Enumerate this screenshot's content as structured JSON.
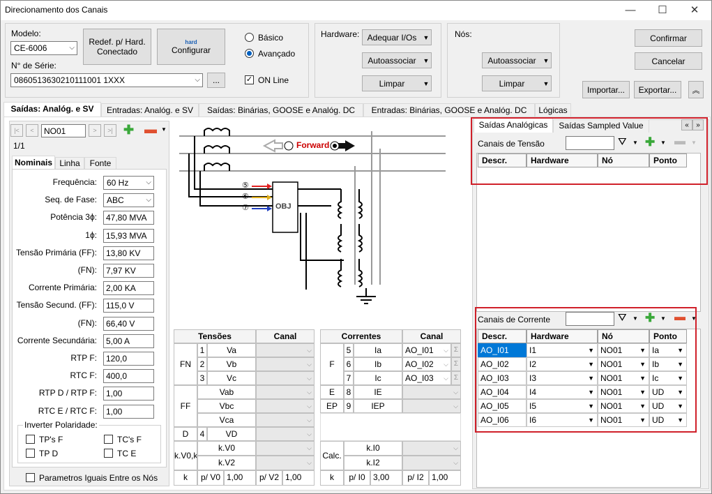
{
  "window": {
    "title": "Direcionamento dos Canais",
    "min": "—",
    "max": "☐",
    "close": "✕"
  },
  "model": {
    "label": "Modelo:",
    "value": "CE-6006",
    "serial_label": "N° de Série:",
    "serial_value": "0860513630210111001 1XXX",
    "browse": "..."
  },
  "buttons": {
    "redef": "Redef. p/ Hard. Conectado",
    "configurar": "Configurar",
    "hard_icon": "hard"
  },
  "mode": {
    "basico": "Básico",
    "avancado": "Avançado",
    "online": "ON Line"
  },
  "hardware": {
    "label": "Hardware:",
    "adequar": "Adequar I/Os",
    "autoassociar": "Autoassociar",
    "limpar": "Limpar"
  },
  "nos": {
    "label": "Nós:",
    "autoassociar": "Autoassociar",
    "limpar": "Limpar"
  },
  "actions": {
    "confirmar": "Confirmar",
    "cancelar": "Cancelar",
    "importar": "Importar...",
    "exportar": "Exportar..."
  },
  "tabs": [
    "Saídas: Analóg. e SV",
    "Entradas: Analóg. e SV",
    "Saídas: Binárias, GOOSE e Analóg. DC",
    "Entradas: Binárias, GOOSE e Analóg. DC",
    "Lógicas"
  ],
  "nav": {
    "current": "NO01",
    "page": "1/1"
  },
  "subtabs": [
    "Nominais",
    "Linha",
    "Fonte"
  ],
  "nominais": [
    {
      "label": "Frequência:",
      "value": "60 Hz",
      "combo": true
    },
    {
      "label": "Seq. de Fase:",
      "value": "ABC",
      "combo": true
    },
    {
      "label": "Potência 3ϕ:",
      "value": "47,80 MVA"
    },
    {
      "label": "1ϕ:",
      "value": "15,93 MVA"
    },
    {
      "label": "Tensão Primária (FF):",
      "value": "13,80 KV"
    },
    {
      "label": "(FN):",
      "value": "7,97 KV"
    },
    {
      "label": "Corrente Primária:",
      "value": "2,00 KA"
    },
    {
      "label": "Tensão Secund. (FF):",
      "value": "115,0 V"
    },
    {
      "label": "(FN):",
      "value": "66,40 V"
    },
    {
      "label": "Corrente Secundária:",
      "value": "5,00 A"
    },
    {
      "label": "RTP F:",
      "value": "120,0"
    },
    {
      "label": "RTC F:",
      "value": "400,0"
    },
    {
      "label": "RTP D / RTP F:",
      "value": "1,00"
    },
    {
      "label": "RTC E / RTC F:",
      "value": "1,00"
    }
  ],
  "polaridade": {
    "label": "Inverter Polaridade:",
    "tpf": "TP's F",
    "tcf": "TC's F",
    "tpd": "TP D",
    "tce": "TC E"
  },
  "iguais": "Parametros Iguais Entre os Nós",
  "diagram": {
    "forward": "Forward",
    "obj": "OBJ",
    "n5": "⑤",
    "n6": "⑥",
    "n7": "⑦"
  },
  "tensoes": {
    "title": "Tensões",
    "canal": "Canal",
    "fn": "FN",
    "ff": "FF",
    "d": "D",
    "calc": [
      "k.V0",
      "k.V2"
    ],
    "k": "k",
    "rows_fn": [
      {
        "n": "1",
        "name": "Va"
      },
      {
        "n": "2",
        "name": "Vb"
      },
      {
        "n": "3",
        "name": "Vc"
      }
    ],
    "rows_ff": [
      "Vab",
      "Vbc",
      "Vca"
    ],
    "row_d": {
      "n": "4",
      "name": "VD"
    },
    "pv0": "p/ V0",
    "pv0_val": "1,00",
    "pv2": "p/ V2",
    "pv2_val": "1,00"
  },
  "correntes": {
    "title": "Correntes",
    "canal": "Canal",
    "f": "F",
    "e": "E",
    "ep": "EP",
    "calc": "Calc.",
    "k": "k",
    "rows_f": [
      {
        "n": "5",
        "name": "Ia",
        "ch": "AO_I01"
      },
      {
        "n": "6",
        "name": "Ib",
        "ch": "AO_I02"
      },
      {
        "n": "7",
        "name": "Ic",
        "ch": "AO_I03"
      }
    ],
    "row_e": {
      "n": "8",
      "name": "IE"
    },
    "row_ep": {
      "n": "9",
      "name": "IEP"
    },
    "calc_rows": [
      "k.I0",
      "k.I2"
    ],
    "pi0": "p/ I0",
    "pi0_val": "3,00",
    "pi2": "p/ I2",
    "pi2_val": "1,00"
  },
  "right": {
    "tabs": [
      "Saídas Analógicas",
      "Saídas Sampled Value"
    ],
    "tensao_label": "Canais de Tensão",
    "corrente_label": "Canais de Corrente",
    "cols": [
      "Descr.",
      "Hardware",
      "Nó",
      "Ponto"
    ],
    "rows": [
      {
        "descr": "AO_I01",
        "hw": "I1",
        "no": "NO01",
        "ponto": "Ia"
      },
      {
        "descr": "AO_I02",
        "hw": "I2",
        "no": "NO01",
        "ponto": "Ib"
      },
      {
        "descr": "AO_I03",
        "hw": "I3",
        "no": "NO01",
        "ponto": "Ic"
      },
      {
        "descr": "AO_I04",
        "hw": "I4",
        "no": "NO01",
        "ponto": "UD"
      },
      {
        "descr": "AO_I05",
        "hw": "I5",
        "no": "NO01",
        "ponto": "UD"
      },
      {
        "descr": "AO_I06",
        "hw": "I6",
        "no": "NO01",
        "ponto": "UD"
      }
    ]
  },
  "colors": {
    "accent": "#0078d7",
    "highlight": "#d0202a",
    "green": "#3aa83a"
  }
}
